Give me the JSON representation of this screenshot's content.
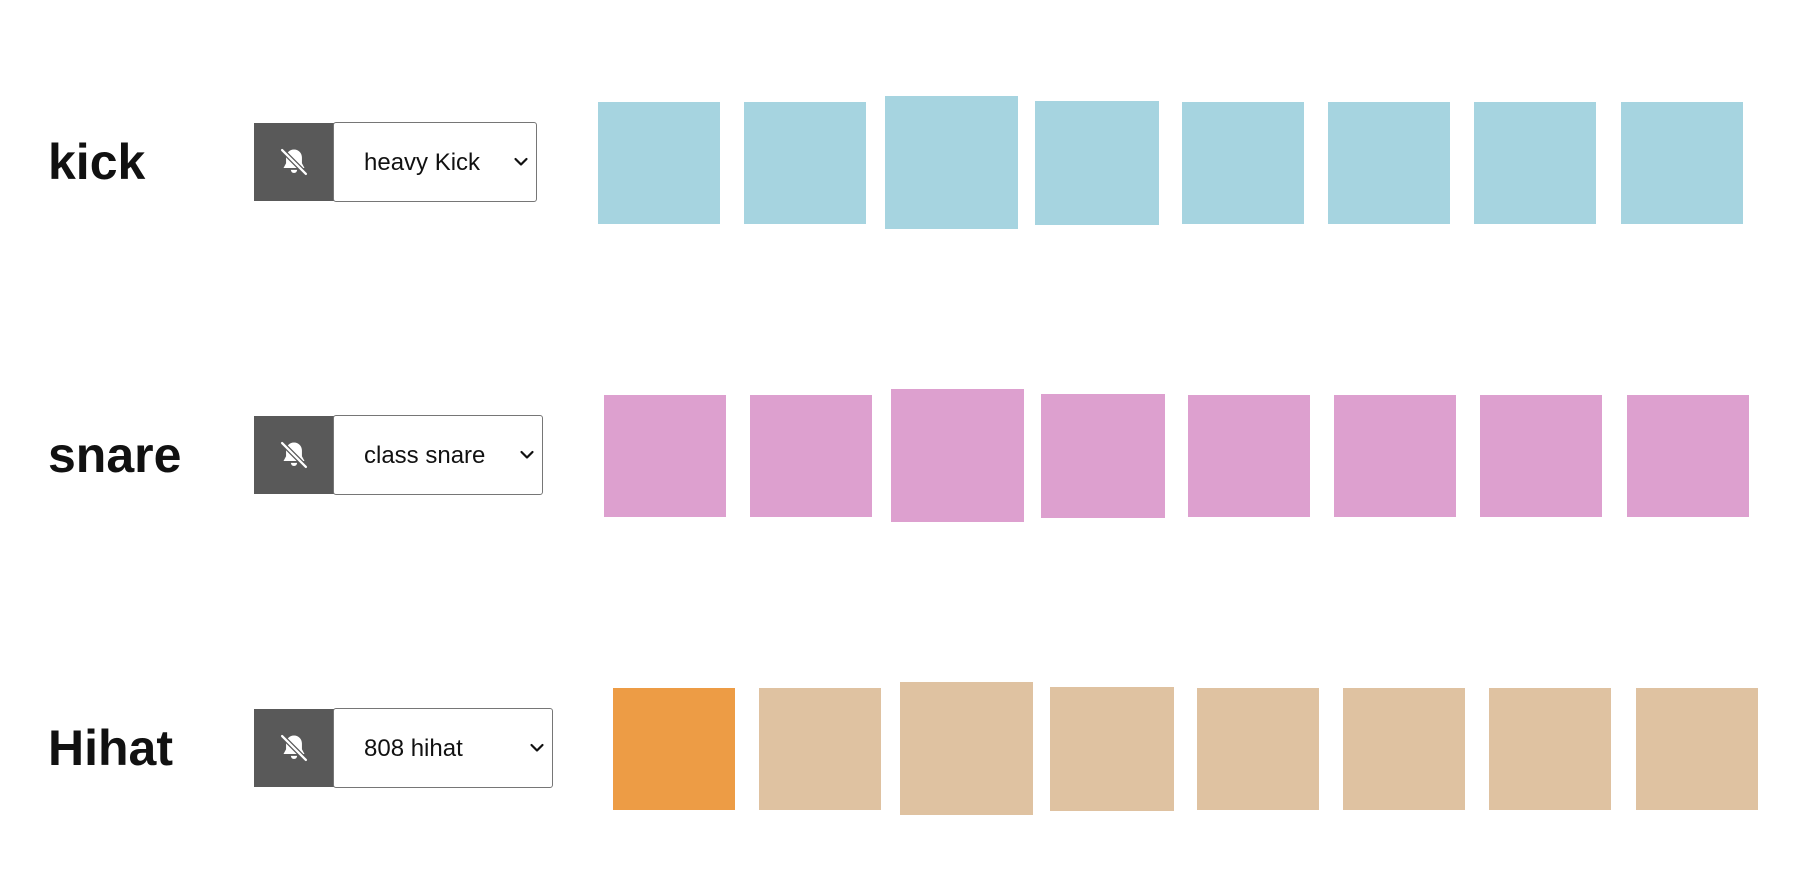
{
  "colors": {
    "kick_pad": "#a6d4e0",
    "snare_pad": "#dda0cf",
    "hihat_pad": "#dfc2a1",
    "active_pad": "#ed9c45",
    "mute_button_bg": "#595959"
  },
  "tracks": [
    {
      "name": "kick",
      "mute_icon": "bell-slash-icon",
      "sample_selected": "heavy Kick",
      "pads": [
        false,
        false,
        false,
        false,
        false,
        false,
        false,
        false
      ]
    },
    {
      "name": "snare",
      "mute_icon": "bell-slash-icon",
      "sample_selected": "class snare",
      "pads": [
        false,
        false,
        false,
        false,
        false,
        false,
        false,
        false
      ]
    },
    {
      "name": "Hihat",
      "mute_icon": "bell-slash-icon",
      "sample_selected": "808 hihat",
      "pads": [
        true,
        false,
        false,
        false,
        false,
        false,
        false,
        false
      ]
    }
  ]
}
